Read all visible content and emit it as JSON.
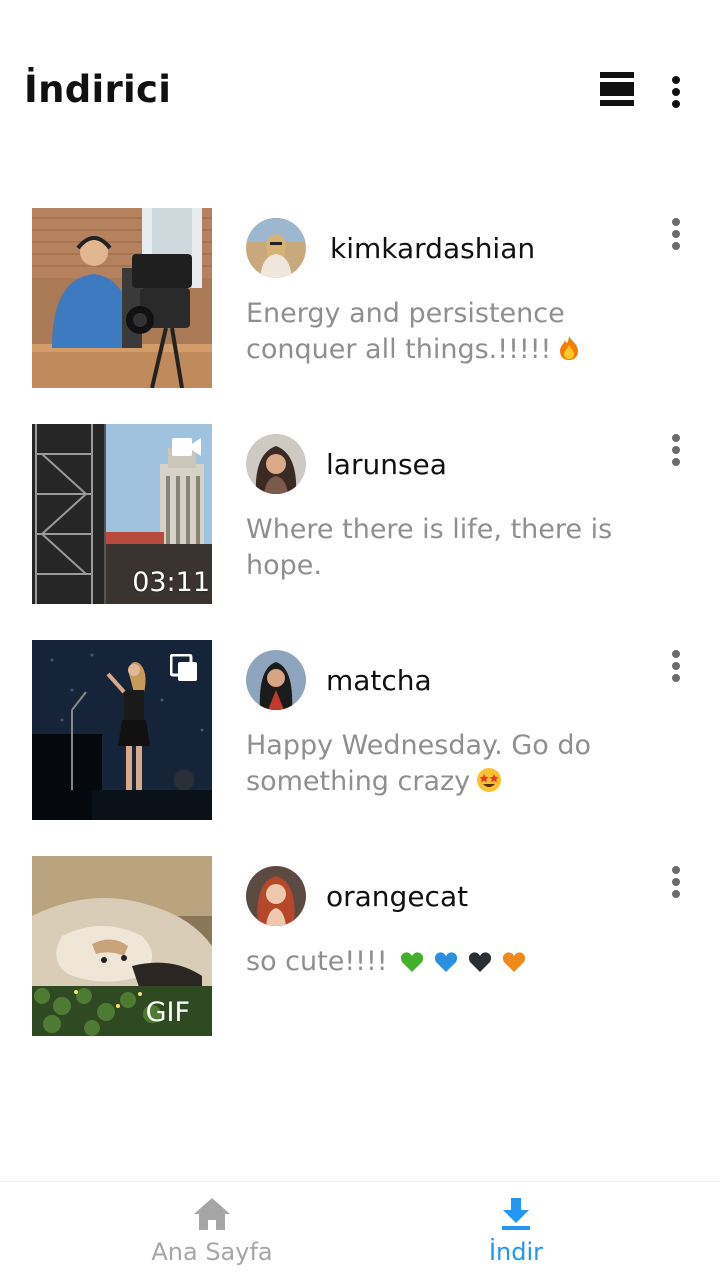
{
  "app": {
    "title": "İndirici"
  },
  "header": {
    "view_toggle_icon": "view-list-icon",
    "overflow_icon": "more-vertical-icon"
  },
  "posts": [
    {
      "username": "kimkardashian",
      "caption": "Energy and persistence conquer all things.!!!!!",
      "caption_emoji": "fire-emoji",
      "media_type": "image",
      "badge": ""
    },
    {
      "username": "larunsea",
      "caption": "Where there is life, there is hope.",
      "media_type": "video",
      "badge": "03:11"
    },
    {
      "username": "matcha",
      "caption": "Happy Wednesday. Go do something crazy",
      "caption_emoji": "star-struck-emoji",
      "media_type": "album",
      "badge": ""
    },
    {
      "username": "orangecat",
      "caption": "so cute!!!!",
      "caption_emoji": "hearts-green-blue-black-orange",
      "media_type": "gif",
      "badge": "GIF"
    }
  ],
  "bottom_nav": {
    "home_label": "Ana Sayfa",
    "download_label": "İndir",
    "active": "download",
    "colors": {
      "active": "#2196f3",
      "inactive": "#a6a6a6"
    }
  }
}
